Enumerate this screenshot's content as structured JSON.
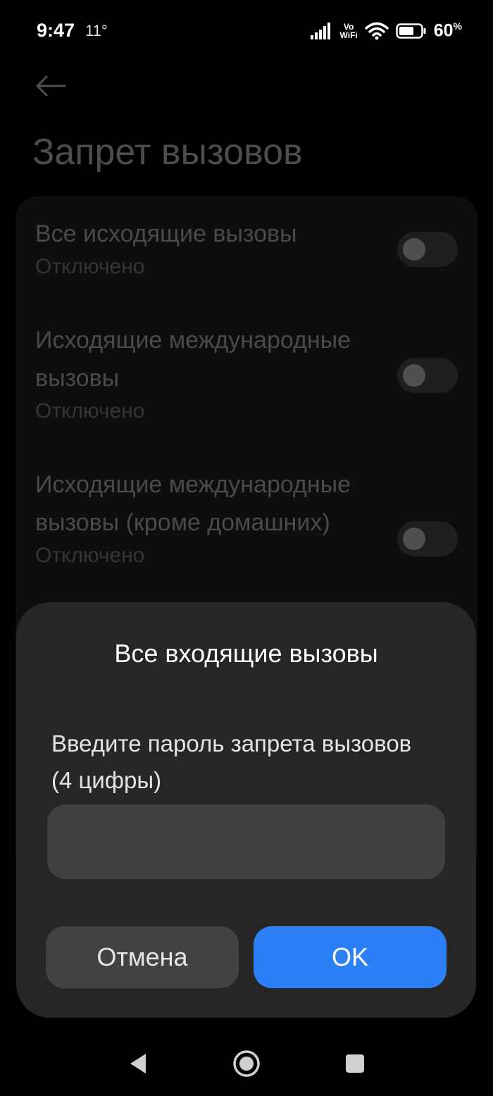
{
  "status_bar": {
    "time": "9:47",
    "temperature": "11°",
    "vowifi_top": "Vo",
    "vowifi_bottom": "WiFi",
    "battery": "60",
    "battery_unit": "%"
  },
  "header": {
    "title": "Запрет вызовов"
  },
  "settings": {
    "items": [
      {
        "title": "Все исходящие вызовы",
        "status": "Отключено",
        "enabled": false
      },
      {
        "title": "Исходящие международные вызовы",
        "status": "Отключено",
        "enabled": false
      },
      {
        "title": "Исходящие международные вызовы (кроме домашних)",
        "status": "Отключено",
        "enabled": false
      }
    ]
  },
  "dialog": {
    "title": "Все входящие вызовы",
    "message": "Введите пароль запрета вызовов (4 цифры)",
    "input_value": "",
    "cancel_label": "Отмена",
    "ok_label": "OK"
  },
  "colors": {
    "accent": "#2c7ff5",
    "dialog_bg": "#262626",
    "background": "#000000"
  },
  "nav": {
    "back": "back-triangle-icon",
    "home": "home-circle-icon",
    "recents": "recents-square-icon"
  }
}
